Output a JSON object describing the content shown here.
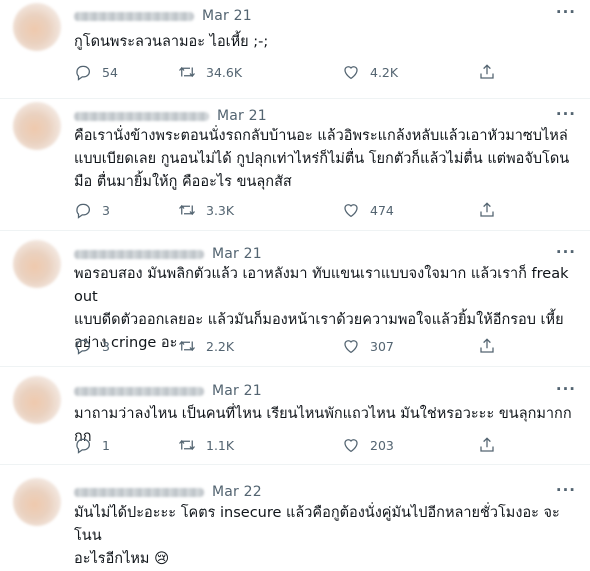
{
  "tweets": [
    {
      "date": "Mar 21",
      "text": "กูโดนพระลวนลามอะ ไอเหี้ย ;-;",
      "replies": "54",
      "retweets": "34.6K",
      "likes": "4.2K"
    },
    {
      "date": "Mar 21",
      "text": "คือเรานั่งข้างพระตอนนั่งรถกลับบ้านอะ แล้วอิพระแกล้งหลับแล้วเอาหัวมาซบไหล่\nแบบเบียดเลย กูนอนไม่ได้ กูปลุกเท่าไหร่ก็ไม่ตื่น โยกตัวก็แล้วไม่ตื่น แต่พอจับโดน\nมือ ตื่นมายิ้มให้กู คืออะไร ขนลุกสัส",
      "replies": "3",
      "retweets": "3.3K",
      "likes": "474"
    },
    {
      "date": "Mar 21",
      "text": "พอรอบสอง มันพลิกตัวแล้ว เอาหลังมา ทับแขนเราแบบจงใจมาก แล้วเราก็ freak out\nแบบดีดตัวออกเลยอะ แล้วมันก็มองหน้าเราด้วยความพอใจแล้วยิ้มให้อีกรอบ เหี้ย\nอย่าง cringe อะ",
      "replies": "3",
      "retweets": "2.2K",
      "likes": "307"
    },
    {
      "date": "Mar 21",
      "text": "มาถามว่าลงไหน เป็นคนที่ไหน เรียนไหนพักแถวไหน มันใช่หรอวะะะ ขนลุกมากกกก",
      "replies": "1",
      "retweets": "1.1K",
      "likes": "203"
    },
    {
      "date": "Mar 22",
      "text": "มันไม่ได้ปะอะะะ โคตร insecure แล้วคือกูต้องนั่งคู่มันไปอีกหลายชั่วโมงอะ จะโนน\nอะไรอีกไหม 😢",
      "replies": "",
      "retweets": "",
      "likes": ""
    }
  ],
  "ui": {
    "more_glyph": "···",
    "separator": "·"
  },
  "colors": {
    "text": "#0f1419",
    "muted": "#536471",
    "divider": "#eff3f4"
  },
  "icons": [
    "reply-icon",
    "retweet-icon",
    "like-icon",
    "share-icon",
    "more-icon"
  ]
}
